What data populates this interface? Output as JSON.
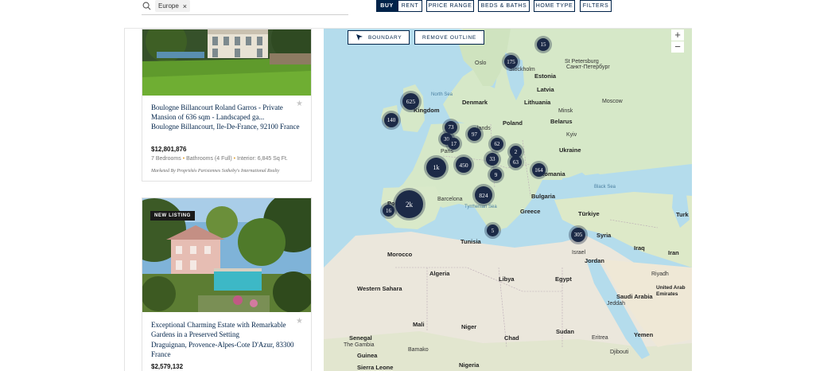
{
  "search": {
    "chip": "Europe",
    "chip_remove": "×"
  },
  "filters": [
    {
      "label": "BUY",
      "active": true
    },
    {
      "label": "RENT",
      "active": false
    },
    {
      "label": "PRICE RANGE",
      "active": false
    },
    {
      "label": "BEDS & BATHS",
      "active": false
    },
    {
      "label": "HOME TYPE",
      "active": false
    },
    {
      "label": "FILTERS",
      "active": false
    }
  ],
  "listings": [
    {
      "title": "Boulogne Billancourt Roland Garros - Private Mansion of 636 sqm - Landscaped ga...",
      "address": "Boulogne Billancourt, Ile-De-France, 92100 France",
      "price": "$12,801,876",
      "bedrooms": "7 Bedrooms",
      "bathrooms": "Bathrooms (4 Full)",
      "interior": "Interior: 6,845 Sq Ft.",
      "marketed_by": "Marketed By Propriétés Parisiennes Sotheby's International Realty"
    },
    {
      "badge": "NEW LISTING",
      "title": "Exceptional Charming Estate with Remarkable Gardens in a Preserved Setting",
      "address": "Draguignan, Provence-Alpes-Cote D'Azur, 83300 France",
      "price": "$2,579,132"
    }
  ],
  "map": {
    "boundary_label": "BOUNDARY",
    "remove_outline_label": "REMOVE OUTLINE",
    "zoom_in": "+",
    "zoom_out": "−",
    "clusters": [
      "15",
      "175",
      "625",
      "140",
      "73",
      "97",
      "30",
      "17",
      "62",
      "2",
      "33",
      "63",
      "164",
      "1k",
      "450",
      "9",
      "824",
      "2k",
      "16",
      "5",
      "305"
    ],
    "places": {
      "st_petersburg": "St Petersburg",
      "st_petersburg_ru": "Санкт-Петербург",
      "stockholm": "Stockholm",
      "estonia": "Estonia",
      "latvia": "Latvia",
      "lithuania": "Lithuania",
      "denmark": "Denmark",
      "north_sea": "North Sea",
      "kingdom": "Kingdom",
      "poland": "Poland",
      "belarus": "Belarus",
      "paris": "Paris",
      "ukraine": "Ukraine",
      "romania": "Romania",
      "bulgaria": "Bulgaria",
      "black_sea": "Black Sea",
      "barcelona": "Barcelona",
      "portugal": "Portug",
      "greece": "Greece",
      "turkiye": "Türkiye",
      "tyrrhenian": "Tyrrhenian Sea",
      "tunisia": "Tunisia",
      "morocco": "Morocco",
      "algeria": "Algeria",
      "libya": "Libya",
      "egypt": "Egypt",
      "syria": "Syria",
      "israel": "Israel",
      "jordan": "Jordan",
      "iraq": "Iraq",
      "iran": "Iran",
      "turk": "Turk",
      "saudi_arabia": "Saudi Arabia",
      "western_sahara": "Western Sahara",
      "mali": "Mali",
      "niger": "Niger",
      "chad": "Chad",
      "sudan": "Sudan",
      "yemen": "Yemen",
      "eritrea": "Eritrea",
      "jeddah": "Jeddah",
      "riyadh": "Riyadh",
      "senegal": "Senegal",
      "the_gambia": "The Gambia",
      "bamako": "Bamako",
      "guinea": "Guinea",
      "sierra_leone": "Sierra Leone",
      "nigeria": "Nigeria",
      "djibouti": "Djibouti",
      "uae": "United Arab Emirates",
      "oslo": "Oslo",
      "minsk": "Minsk",
      "kyiv": "Kyiv",
      "lands": "lands",
      "moscow": "Moscow"
    }
  },
  "colors": {
    "navy": "#002349",
    "cluster": "#1c2a47",
    "sea": "#b4dcec",
    "land": "#d8ead0",
    "desert": "#ebe7dc"
  }
}
